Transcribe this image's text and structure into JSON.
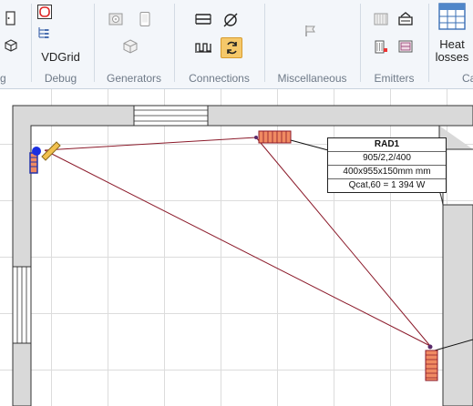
{
  "ribbon": {
    "groups": [
      {
        "id": "g0",
        "label": "g"
      },
      {
        "id": "debug",
        "label": "Debug",
        "button_label": "VDGrid"
      },
      {
        "id": "generators",
        "label": "Generators"
      },
      {
        "id": "connections",
        "label": "Connections"
      },
      {
        "id": "misc",
        "label": "Miscellaneous"
      },
      {
        "id": "emitters",
        "label": "Emitters"
      },
      {
        "id": "heat",
        "label": "Ca",
        "button_label_1": "Heat",
        "button_label_2": "losses"
      }
    ],
    "icons": {
      "g0_top": "door-small-icon",
      "g0_bottom": "cube-outline-icon",
      "debug_top": "red-square-icon",
      "debug_mid": "tree-list-icon",
      "gen_1": "boiler-icon",
      "gen_2": "phone-device-icon",
      "gen_3": "cube-icon",
      "conn_1": "parallel-pipes-icon",
      "conn_2": "diameter-icon",
      "conn_3": "floor-heating-icon",
      "conn_4": "refresh-active-icon",
      "misc_1": "flag-icon",
      "emit_1": "panel-radiator-icon",
      "emit_2": "fan-coil-icon",
      "emit_3": "radiator-red-icon",
      "emit_4": "radiator-purple-icon",
      "heat": "table-grid-icon"
    },
    "accent_active": "#f5c86a"
  },
  "canvas": {
    "pipe_color": "#8b1a2a",
    "wall_color": "#d9d9d9",
    "radiator_color": "#f08a62",
    "callout": {
      "name": "RAD1",
      "model": "905/2,2/400",
      "size": "400x955x150mm mm",
      "qcat": "Qcat,60 = 1 394 W"
    }
  }
}
